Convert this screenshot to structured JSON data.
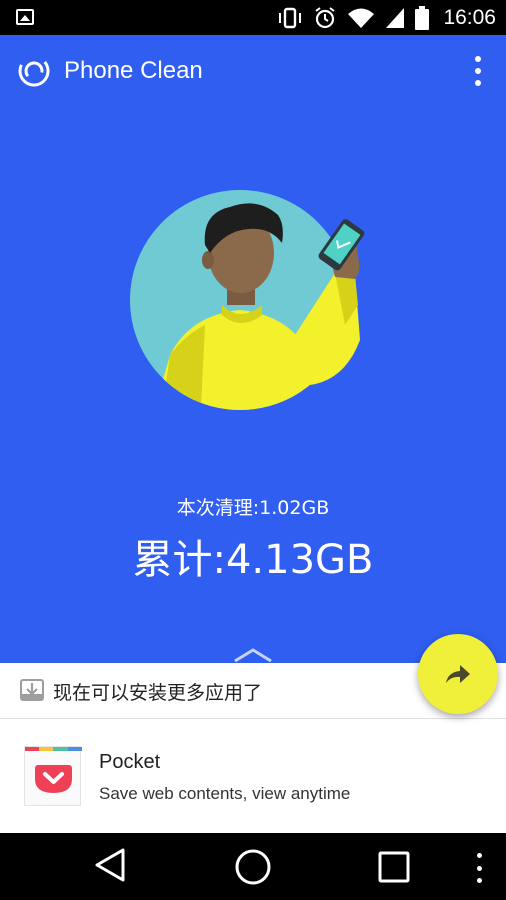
{
  "status_bar": {
    "time": "16:06",
    "icons": [
      "image-notification-icon",
      "vibrate-icon",
      "alarm-icon",
      "wifi-icon",
      "signal-icon",
      "battery-icon"
    ]
  },
  "app": {
    "title": "Phone Clean",
    "background_color": "#2f5ef0",
    "accent_color": "#f0ef3a",
    "session_clean_label": "本次清理:1.02GB",
    "total_clean_label": "累计:4.13GB"
  },
  "panel": {
    "install_prompt": "现在可以安装更多应用了",
    "recommended_app": {
      "name": "Pocket",
      "description": "Save web contents, view anytime",
      "icon": "pocket-app-icon"
    }
  },
  "fab": {
    "icon": "share-arrow-icon"
  },
  "nav_bar": {
    "buttons": [
      "back-icon",
      "home-icon",
      "recents-icon",
      "menu-icon"
    ]
  }
}
